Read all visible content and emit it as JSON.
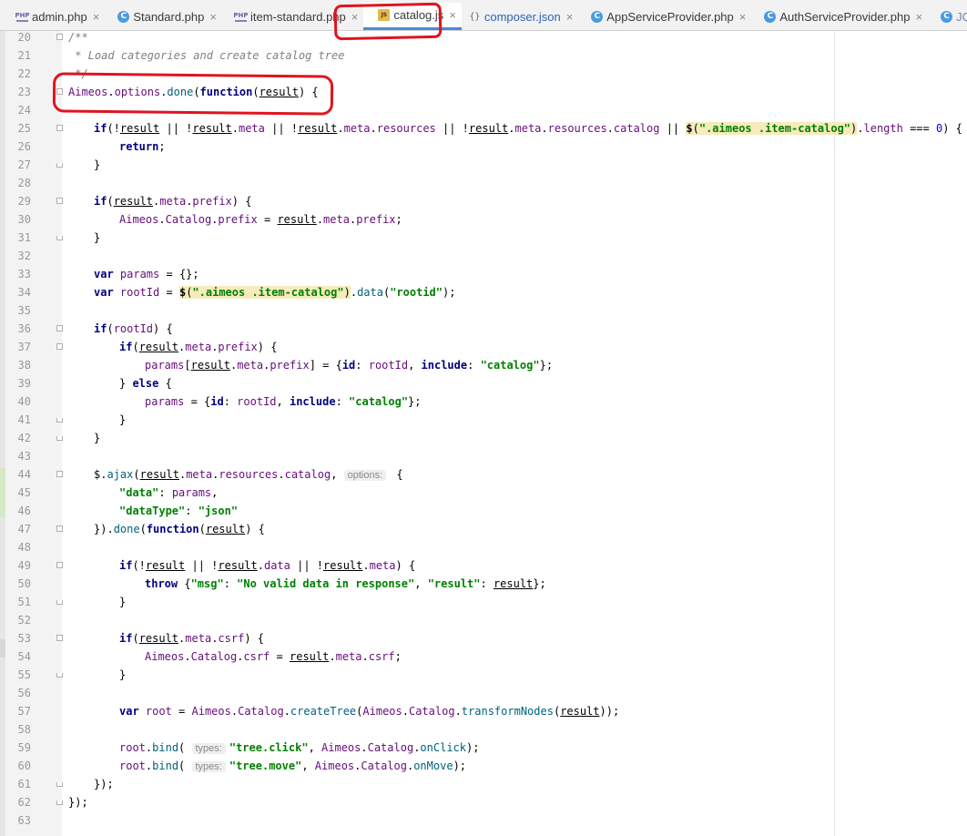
{
  "tabs": [
    {
      "label": "admin.php",
      "icon": "php"
    },
    {
      "label": "Standard.php",
      "icon": "class"
    },
    {
      "label": "item-standard.php",
      "icon": "php"
    },
    {
      "label": "catalog.js",
      "icon": "js",
      "active": true
    },
    {
      "label": "composer.json",
      "icon": "json"
    },
    {
      "label": "AppServiceProvider.php",
      "icon": "class"
    },
    {
      "label": "AuthServiceProvider.php",
      "icon": "class"
    },
    {
      "label": "JQAdm.php",
      "icon": "class"
    }
  ],
  "editor": {
    "lines": [
      {
        "n": "20"
      },
      {
        "n": "21"
      },
      {
        "n": "22"
      },
      {
        "n": "23"
      },
      {
        "n": "24"
      },
      {
        "n": "25"
      },
      {
        "n": "26"
      },
      {
        "n": "27"
      },
      {
        "n": "28"
      },
      {
        "n": "29"
      },
      {
        "n": "30"
      },
      {
        "n": "31"
      },
      {
        "n": "32"
      },
      {
        "n": "33"
      },
      {
        "n": "34"
      },
      {
        "n": "35"
      },
      {
        "n": "36"
      },
      {
        "n": "37"
      },
      {
        "n": "38"
      },
      {
        "n": "39"
      },
      {
        "n": "40"
      },
      {
        "n": "41"
      },
      {
        "n": "42"
      },
      {
        "n": "43"
      },
      {
        "n": "44"
      },
      {
        "n": "45"
      },
      {
        "n": "46"
      },
      {
        "n": "47"
      },
      {
        "n": "48"
      },
      {
        "n": "49"
      },
      {
        "n": "50"
      },
      {
        "n": "51"
      },
      {
        "n": "52"
      },
      {
        "n": "53"
      },
      {
        "n": "54"
      },
      {
        "n": "55"
      },
      {
        "n": "56"
      },
      {
        "n": "57"
      },
      {
        "n": "58"
      },
      {
        "n": "59"
      },
      {
        "n": "60"
      },
      {
        "n": "61"
      },
      {
        "n": "62"
      },
      {
        "n": "63"
      }
    ],
    "code": {
      "l20": "/**",
      "l21": " * Load categories and create catalog tree",
      "l22": " */",
      "l23": [
        "Aimeos",
        ".",
        "options",
        ".",
        "done",
        "(",
        "function",
        "(",
        "result",
        ") {"
      ],
      "l25": [
        "if",
        "(!",
        "result",
        " || !",
        "result",
        ".",
        "meta",
        " || !",
        "result",
        ".",
        "meta",
        ".",
        "resources",
        " || !",
        "result",
        ".",
        "meta",
        ".",
        "resources",
        ".",
        "catalog",
        " || ",
        "$",
        "(",
        "\".aimeos .item-catalog\"",
        ")",
        ".",
        "length",
        " === ",
        "0",
        ") {"
      ],
      "l26": [
        "return",
        ";"
      ],
      "l27": "}",
      "l29": [
        "if",
        "(",
        "result",
        ".",
        "meta",
        ".",
        "prefix",
        ") {"
      ],
      "l30": [
        "Aimeos",
        ".",
        "Catalog",
        ".",
        "prefix",
        " = ",
        "result",
        ".",
        "meta",
        ".",
        "prefix",
        ";"
      ],
      "l31": "}",
      "l33": [
        "var",
        " params",
        " = {};"
      ],
      "l34": [
        "var",
        " rootId",
        " = ",
        "$",
        "(",
        "\".aimeos .item-catalog\"",
        ")",
        ".",
        "data",
        "(",
        "\"rootid\"",
        ");"
      ],
      "l36": [
        "if",
        "(",
        "rootId",
        ") {"
      ],
      "l37": [
        "if",
        "(",
        "result",
        ".",
        "meta",
        ".",
        "prefix",
        ") {"
      ],
      "l38": [
        "params",
        "[",
        "result",
        ".",
        "meta",
        ".",
        "prefix",
        "] = {",
        "id",
        ": ",
        "rootId",
        ", ",
        "include",
        ": ",
        "\"catalog\"",
        "};"
      ],
      "l39": [
        "} ",
        "else",
        " {"
      ],
      "l40": [
        "params",
        " = {",
        "id",
        ": ",
        "rootId",
        ", ",
        "include",
        ": ",
        "\"catalog\"",
        "};"
      ],
      "l41": "}",
      "l42": "}",
      "l44": [
        "$",
        ".",
        "ajax",
        "(",
        "result",
        ".",
        "meta",
        ".",
        "resources",
        ".",
        "catalog",
        ", ",
        "options:",
        " {"
      ],
      "l45": [
        "\"data\"",
        ": ",
        "params",
        ","
      ],
      "l46": [
        "\"dataType\"",
        ": ",
        "\"json\""
      ],
      "l47": [
        "})",
        ".",
        "done",
        "(",
        "function",
        "(",
        "result",
        ") {"
      ],
      "l49": [
        "if",
        "(!",
        "result",
        " || !",
        "result",
        ".",
        "data",
        " || !",
        "result",
        ".",
        "meta",
        ") {"
      ],
      "l50": [
        "throw",
        " {",
        "\"msg\"",
        ": ",
        "\"No valid data in response\"",
        ", ",
        "\"result\"",
        ": ",
        "result",
        "};"
      ],
      "l51": "}",
      "l53": [
        "if",
        "(",
        "result",
        ".",
        "meta",
        ".",
        "csrf",
        ") {"
      ],
      "l54": [
        "Aimeos",
        ".",
        "Catalog",
        ".",
        "csrf",
        " = ",
        "result",
        ".",
        "meta",
        ".",
        "csrf",
        ";"
      ],
      "l55": "}",
      "l57": [
        "var",
        " root",
        " = ",
        "Aimeos",
        ".",
        "Catalog",
        ".",
        "createTree",
        "(",
        "Aimeos",
        ".",
        "Catalog",
        ".",
        "transformNodes",
        "(",
        "result",
        "));"
      ],
      "l59": [
        "root",
        ".",
        "bind",
        "( ",
        "types:",
        "\"tree.click\"",
        ", ",
        "Aimeos",
        ".",
        "Catalog",
        ".",
        "onClick",
        ");"
      ],
      "l60": [
        "root",
        ".",
        "bind",
        "( ",
        "types:",
        "\"tree.move\"",
        ", ",
        "Aimeos",
        ".",
        "Catalog",
        ".",
        "onMove",
        ");"
      ],
      "l61": "});",
      "l62": "});"
    }
  },
  "colors": {
    "annotation": "#e0141e",
    "active_tab_underline": "#4a8ad6",
    "keyword": "#000080",
    "string": "#008000",
    "comment": "#808080"
  }
}
